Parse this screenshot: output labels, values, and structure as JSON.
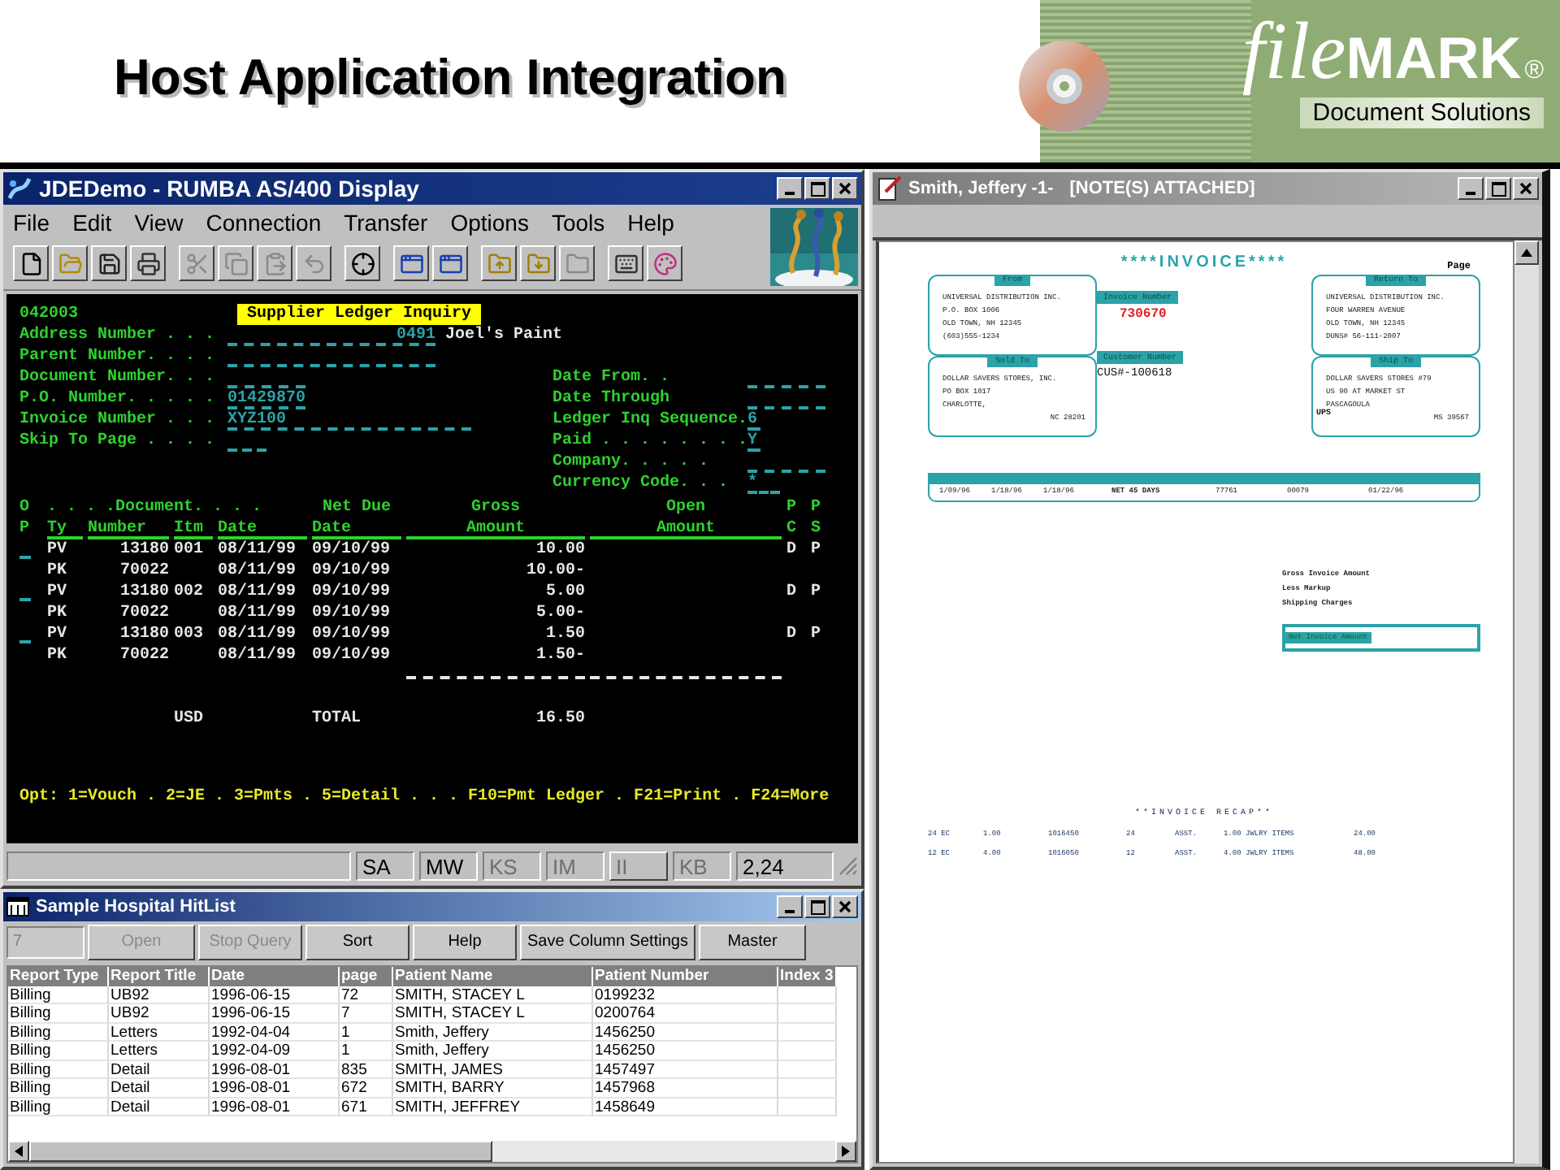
{
  "slide": {
    "title": "Host Application Integration"
  },
  "logo": {
    "script": "file",
    "bold": "MARK",
    "registered": "®",
    "tagline": "Document Solutions"
  },
  "rumba": {
    "title": "JDEDemo - RUMBA AS/400 Display",
    "menu": [
      "File",
      "Edit",
      "View",
      "Connection",
      "Transfer",
      "Options",
      "Tools",
      "Help"
    ],
    "toolbar": [
      {
        "kind": "new",
        "disabled": false
      },
      {
        "kind": "open",
        "disabled": false
      },
      {
        "kind": "save",
        "disabled": false
      },
      {
        "kind": "print",
        "disabled": false
      },
      {
        "kind": "cut",
        "disabled": true
      },
      {
        "kind": "copy",
        "disabled": true
      },
      {
        "kind": "paste",
        "disabled": true
      },
      {
        "kind": "undo",
        "disabled": true
      },
      {
        "kind": "target",
        "disabled": false
      },
      {
        "kind": "window",
        "disabled": false
      },
      {
        "kind": "window",
        "disabled": false
      },
      {
        "kind": "upload",
        "disabled": false
      },
      {
        "kind": "download",
        "disabled": false
      },
      {
        "kind": "folder",
        "disabled": true
      },
      {
        "kind": "keyboard",
        "disabled": false
      },
      {
        "kind": "palette",
        "disabled": false
      }
    ],
    "screen": {
      "screen_id": "042003",
      "heading": "Supplier Ledger Inquiry",
      "left_fields": [
        {
          "label": "Address Number . . .",
          "value": "0491",
          "description": "Joel's Paint"
        },
        {
          "label": "Parent Number. . . ."
        },
        {
          "label": "Document Number. . ."
        },
        {
          "label": "P.O. Number. . . . .",
          "value": "01429870"
        },
        {
          "label": "Invoice Number . . .",
          "value": "XYZ100"
        },
        {
          "label": "Skip To Page . . . ."
        }
      ],
      "right_fields": [
        {
          "label": "Date From. ."
        },
        {
          "label": "Date Through"
        },
        {
          "label": "Ledger Inq Sequence.",
          "value": "6"
        },
        {
          "label": "Paid . . . . . . . .",
          "value": "Y"
        },
        {
          "label": "Company. . . . ."
        },
        {
          "label": "Currency Code. . .",
          "value": "*"
        }
      ],
      "header_top": [
        "O",
        ". . . .Document. . . .",
        "Net Due",
        "Gross",
        "Open",
        "P",
        "P"
      ],
      "header_bottom": [
        "P",
        "Ty",
        "Number",
        "Itm",
        "Date",
        "Date",
        "Amount",
        "Amount",
        "C",
        "S"
      ],
      "rows": [
        {
          "option": true,
          "ty": "PV",
          "number": "13180",
          "itm": "001",
          "date": "08/11/99",
          "net_due": "09/10/99",
          "gross": "10.00",
          "pc": "D",
          "ps": "P"
        },
        {
          "option": false,
          "ty": "PK",
          "number": "70022",
          "date": "08/11/99",
          "net_due": "09/10/99",
          "gross": "10.00-"
        },
        {
          "option": true,
          "ty": "PV",
          "number": "13180",
          "itm": "002",
          "date": "08/11/99",
          "net_due": "09/10/99",
          "gross": "5.00",
          "pc": "D",
          "ps": "P"
        },
        {
          "option": false,
          "ty": "PK",
          "number": "70022",
          "date": "08/11/99",
          "net_due": "09/10/99",
          "gross": "5.00-"
        },
        {
          "option": true,
          "ty": "PV",
          "number": "13180",
          "itm": "003",
          "date": "08/11/99",
          "net_due": "09/10/99",
          "gross": "1.50",
          "pc": "D",
          "ps": "P"
        },
        {
          "option": false,
          "ty": "PK",
          "number": "70022",
          "date": "08/11/99",
          "net_due": "09/10/99",
          "gross": "1.50-"
        }
      ],
      "total": {
        "currency": "USD",
        "label": "TOTAL",
        "gross": "16.50"
      },
      "footer": "Opt: 1=Vouch . 2=JE . 3=Pmts . 5=Detail . . . F10=Pmt Ledger . F21=Print . F24=More"
    },
    "status": [
      {
        "text": "SA",
        "disabled": false
      },
      {
        "text": "MW",
        "disabled": false
      },
      {
        "text": "KS",
        "disabled": true
      },
      {
        "text": "IM",
        "disabled": true
      },
      {
        "text": "II",
        "disabled": true
      },
      {
        "text": "KB",
        "disabled": true
      },
      {
        "text": "2,24",
        "disabled": false
      }
    ]
  },
  "hitlist": {
    "title": "Sample Hospital HitList",
    "count": "7",
    "buttons": [
      {
        "label": "Open",
        "disabled": true
      },
      {
        "label": "Stop Query",
        "disabled": true
      },
      {
        "label": "Sort",
        "disabled": false
      },
      {
        "label": "Help",
        "disabled": false
      },
      {
        "label": "Save Column Settings",
        "disabled": false
      },
      {
        "label": "Master",
        "disabled": false
      }
    ],
    "columns": [
      "Report Type",
      "Report Title",
      "Date",
      "page",
      "Patient Name",
      "Patient Number",
      "Index 3"
    ],
    "rows": [
      [
        "Billing",
        "UB92",
        "1996-06-15",
        "72",
        "SMITH, STACEY L",
        "0199232"
      ],
      [
        "Billing",
        "UB92",
        "1996-06-15",
        "7",
        "SMITH, STACEY L",
        "0200764"
      ],
      [
        "Billing",
        "Letters",
        "1992-04-04",
        "1",
        "Smith, Jeffery",
        "1456250"
      ],
      [
        "Billing",
        "Letters",
        "1992-04-09",
        "1",
        "Smith, Jeffery",
        "1456250"
      ],
      [
        "Billing",
        "Detail",
        "1996-08-01",
        "835",
        "SMITH, JAMES",
        "1457497"
      ],
      [
        "Billing",
        "Detail",
        "1996-08-01",
        "672",
        "SMITH, BARRY",
        "1457968"
      ],
      [
        "Billing",
        "Detail",
        "1996-08-01",
        "671",
        "SMITH, JEFFREY",
        "1458649"
      ]
    ]
  },
  "viewer": {
    "title": "Smith, Jeffery -1-",
    "note": "[NOTE(S) ATTACHED]",
    "invoice": {
      "heading": "****INVOICE****",
      "page_label": "Page",
      "from": {
        "label": "From",
        "lines": [
          "UNIVERSAL DISTRIBUTION INC.",
          "P.O. BOX 1006",
          "OLD TOWN, NH 12345",
          "(603)555-1234"
        ]
      },
      "sold_to": {
        "label": "Sold To",
        "lines": [
          "DOLLAR SAVERS STORES, INC.",
          "PO BOX 1017",
          "CHARLOTTE,",
          "NC 28201"
        ]
      },
      "return_to": {
        "label": "Return To",
        "lines": [
          "UNIVERSAL DISTRIBUTION INC.",
          "FOUR WARREN AVENUE",
          "OLD TOWN, NH 12345",
          "DUNS# 56-111-2007"
        ]
      },
      "ship_to": {
        "label": "Ship To",
        "lines": [
          "DOLLAR SAVERS STORES #79",
          "US 90 AT MARKET ST",
          "PASCAGOULA",
          "MS 39567"
        ]
      },
      "invoice_number": {
        "label": "Invoice Number",
        "value": "730670"
      },
      "customer_number": {
        "label": "Customer Number",
        "value": "CUS#-100618"
      },
      "carrier": "UPS",
      "terms_row": [
        "1/09/96",
        "1/18/96",
        "1/18/96",
        "NET 45 DAYS",
        "77761",
        "00079",
        "01/22/96"
      ],
      "totals": [
        "Gross Invoice Amount",
        "Less Markup",
        "Shipping Charges"
      ],
      "net_label": "Net Invoice Amount",
      "recap_title": "**INVOICE RECAP**",
      "recap_rows": [
        [
          "24 EC",
          "1.00",
          "1016450",
          "24",
          "ASST.",
          "1.00 JWLRY ITEMS",
          "24.00"
        ],
        [
          "12 EC",
          "4.00",
          "1016050",
          "12",
          "ASST.",
          "4.00 JWLRY ITEMS",
          "48.00"
        ]
      ]
    }
  }
}
